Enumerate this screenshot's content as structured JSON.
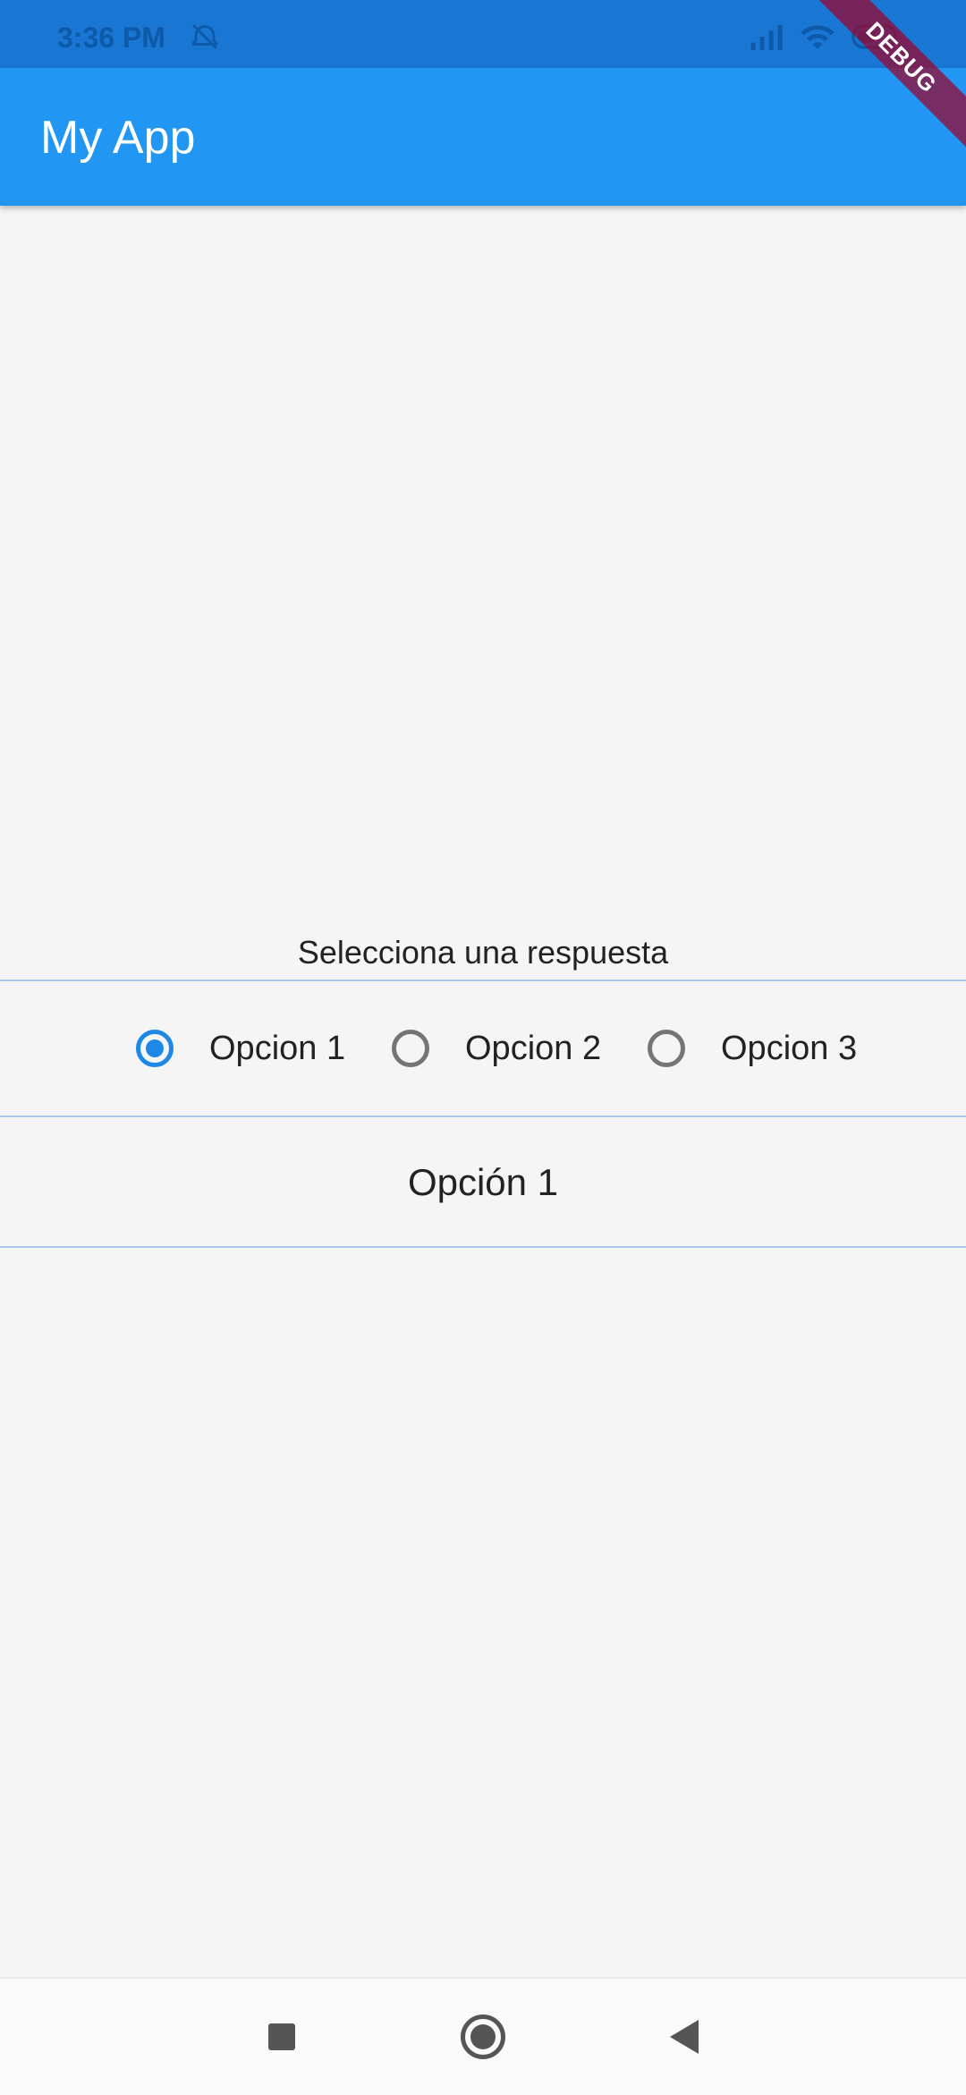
{
  "status_bar": {
    "time": "3:36 PM",
    "icons": [
      "alarm-off-icon",
      "signal-icon",
      "wifi-icon",
      "battery-icon"
    ]
  },
  "app_bar": {
    "title": "My App"
  },
  "debug_banner": "DEBUG",
  "content": {
    "question": "Selecciona una respuesta",
    "options": [
      {
        "label": "Opcion 1",
        "selected": true
      },
      {
        "label": "Opcion 2",
        "selected": false
      },
      {
        "label": "Opcion 3",
        "selected": false
      }
    ],
    "selected_display": "Opción 1"
  },
  "nav_bar": {
    "buttons": [
      "recents-icon",
      "home-icon",
      "back-icon"
    ]
  },
  "colors": {
    "primary": "#2196f3",
    "status_bar": "#1976d2",
    "radio_active": "#1e88e5",
    "radio_inactive": "#757575",
    "background": "#f5f5f5"
  }
}
